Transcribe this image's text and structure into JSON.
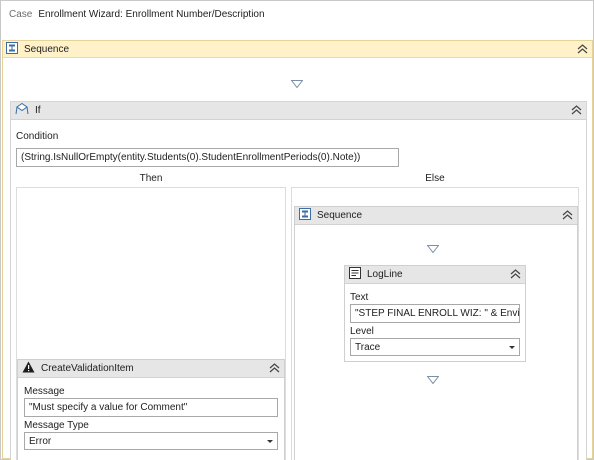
{
  "breadcrumb": {
    "label": "Case",
    "current": "Enrollment Wizard: Enrollment Number/Description"
  },
  "outer_sequence": {
    "title": "Sequence"
  },
  "if_activity": {
    "title": "If",
    "condition_label": "Condition",
    "condition_value": "(String.IsNullOrEmpty(entity.Students(0).StudentEnrollmentPeriods(0).Note))",
    "then_label": "Then",
    "else_label": "Else"
  },
  "create_validation_item": {
    "title": "CreateValidationItem",
    "message_label": "Message",
    "message_value": "\"Must specify a value for Comment\"",
    "message_type_label": "Message Type",
    "message_type_value": "Error"
  },
  "else_sequence": {
    "title": "Sequence"
  },
  "logline": {
    "title": "LogLine",
    "text_label": "Text",
    "text_value": "\"STEP FINAL ENROLL WIZ: \" & Envir",
    "level_label": "Level",
    "level_value": "Trace"
  },
  "colors": {
    "sequence_header": "#fff2c8",
    "activity_header": "#e6e6e6",
    "border": "#c9c9c9"
  }
}
